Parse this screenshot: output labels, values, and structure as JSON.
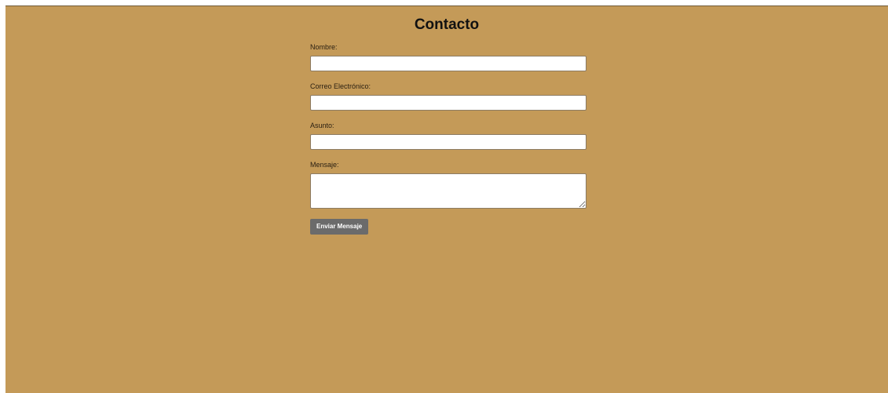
{
  "page": {
    "title": "Contacto",
    "background_color": "#c49a58"
  },
  "form": {
    "fields": [
      {
        "label": "Nombre:",
        "value": "",
        "type": "text"
      },
      {
        "label": "Correo Electrónico:",
        "value": "",
        "type": "email"
      },
      {
        "label": "Asunto:",
        "value": "",
        "type": "text"
      },
      {
        "label": "Mensaje:",
        "value": "",
        "type": "textarea"
      }
    ],
    "submit_label": "Enviar Mensaje",
    "submit_color": "#6b6b6b"
  }
}
